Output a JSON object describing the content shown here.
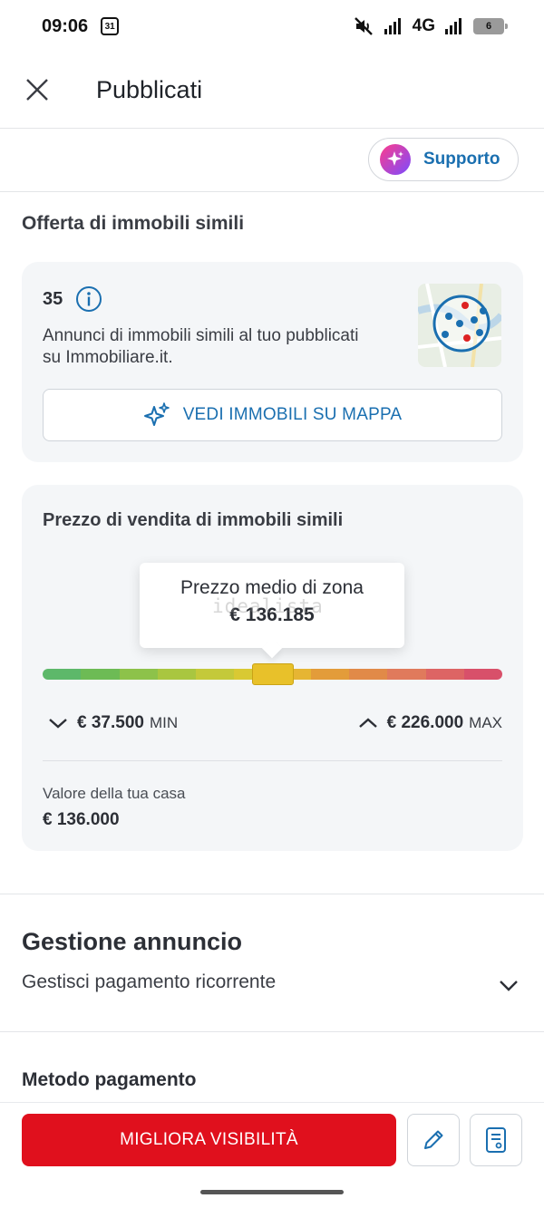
{
  "status_bar": {
    "time": "09:06",
    "calendar_day": "31",
    "network": "4G",
    "battery": "6"
  },
  "header": {
    "title": "Pubblicati"
  },
  "support": {
    "label": "Supporto"
  },
  "offer": {
    "section_title": "Offerta di immobili simili",
    "count": "35",
    "description": "Annunci di immobili simili al tuo pubblicati su Immobiliare.it.",
    "map_button_label": "VEDI IMMOBILI SU MAPPA"
  },
  "price": {
    "title": "Prezzo di vendita di immobili simili",
    "tooltip_label": "Prezzo medio di zona",
    "tooltip_value": "€ 136.185",
    "watermark": "idealista",
    "min_value": "€ 37.500",
    "min_label": "MIN",
    "max_value": "€ 226.000",
    "max_label": "MAX",
    "home_label": "Valore della tua casa",
    "home_value": "€ 136.000",
    "bar_colors": [
      "#5db86a",
      "#6dbb55",
      "#8dc24a",
      "#a9c640",
      "#c4c93a",
      "#d9c933",
      "#e6b533",
      "#e39c3a",
      "#e18a48",
      "#e07a5c",
      "#dd6464",
      "#d8506a"
    ],
    "marker_position_fraction": 0.5
  },
  "management": {
    "title": "Gestione annuncio",
    "row_label": "Gestisci pagamento ricorrente",
    "payment_title": "Metodo pagamento"
  },
  "bottom": {
    "cta_label": "MIGLIORA VISIBILITÀ"
  },
  "colors": {
    "accent_blue": "#1a6fb0",
    "cta_red": "#e0101d"
  }
}
